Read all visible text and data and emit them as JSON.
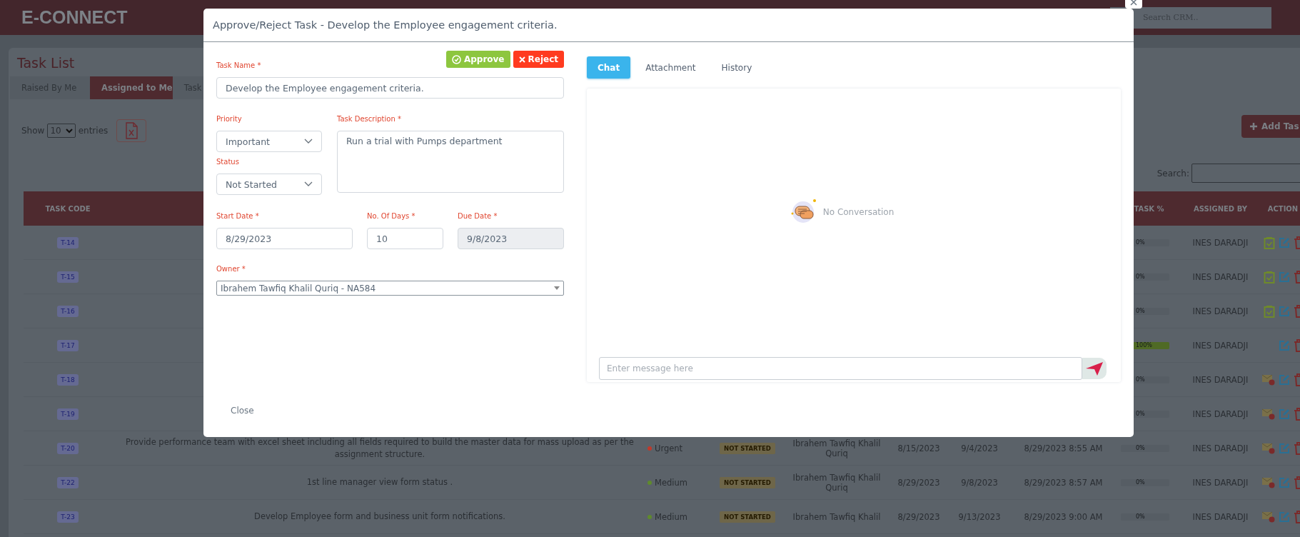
{
  "header": {
    "logo": "E-CONNECT",
    "search_placeholder": "Search CRM.."
  },
  "page": {
    "title": "Task List",
    "tabs": [
      {
        "label": "Raised By Me",
        "selected": false
      },
      {
        "label": "Assigned to Me",
        "selected": true
      },
      {
        "label": "Task",
        "selected": false
      }
    ],
    "show_label": "Show",
    "page_size": "10",
    "entries_label": "entries",
    "add_button": "Add Tas",
    "search_label": "Search:"
  },
  "table": {
    "columns": {
      "code": "TASK CODE",
      "progress": "TASK %",
      "assigned_by": "ASSIGNED BY",
      "action": "ACTION"
    },
    "rows": [
      {
        "code": "T-14",
        "level": 0,
        "progress_label": "0%",
        "assigned_by": "INES DARADJI",
        "approval_pending": true,
        "unread_alert": false
      },
      {
        "code": "T-15",
        "level": 0,
        "progress_label": "0%",
        "assigned_by": "INES DARADJI",
        "approval_pending": true,
        "unread_alert": false
      },
      {
        "code": "T-16",
        "level": 0,
        "progress_label": "0%",
        "assigned_by": "INES DARADJI",
        "approval_pending": true,
        "unread_alert": false
      },
      {
        "code": "T-17",
        "level": 1,
        "progress_label": "100%",
        "assigned_by": "INES DARADJI",
        "approval_pending": false,
        "unread_alert": false
      },
      {
        "code": "T-18",
        "level": 0,
        "progress_label": "0%",
        "assigned_by": "INES DARADJI",
        "approval_pending": false,
        "unread_alert": true
      },
      {
        "code": "T-19",
        "level": 0,
        "progress_label": "0%",
        "assigned_by": "INES DARADJI",
        "approval_pending": false,
        "unread_alert": true
      },
      {
        "code": "T-20",
        "description": "Provide performance team with excel sheet including all fields required to build the master data for mass upload as per the assignment structure.",
        "priority": {
          "label": "Urgent",
          "color": "#c0392b"
        },
        "status": "NOT STARTED",
        "owner": "Ibrahem Tawfiq Khalil Quriq",
        "start": "8/15/2023",
        "due": "9/4/2023",
        "created": "8/29/2023 8:55 AM",
        "level": 0,
        "progress_label": "0%",
        "assigned_by": "INES DARADJI",
        "approval_pending": false,
        "unread_alert": true
      },
      {
        "code": "T-22",
        "description": "1st line manager view form status .",
        "priority": {
          "label": "Medium",
          "color": "#5f8a2c"
        },
        "status": "NOT STARTED",
        "owner": "Ibrahem Tawfiq Khalil Quriq",
        "start": "8/29/2023",
        "due": "9/8/2023",
        "created": "8/29/2023 8:57 AM",
        "level": 0,
        "progress_label": "0%",
        "assigned_by": "INES DARADJI",
        "approval_pending": false,
        "unread_alert": true
      },
      {
        "code": "T-23",
        "description": "Develop Employee form and business unit form notifications.",
        "priority": {
          "label": "Medium",
          "color": "#5f8a2c"
        },
        "status": "NOT STARTED",
        "owner": "Ibrahem Tawfiq Khalil",
        "start": "8/29/2023",
        "due": "9/13/2023",
        "created": "8/29/2023 9:00 AM",
        "level": 0,
        "progress_label": "0%",
        "assigned_by": "INES DARADJI",
        "approval_pending": false,
        "unread_alert": true
      }
    ]
  },
  "modal": {
    "title": "Approve/Reject Task - Develop the Employee engagement criteria.",
    "approve": "Approve",
    "reject": "Reject",
    "form": {
      "task_name": {
        "label": "Task Name *",
        "value": "Develop the Employee engagement criteria.",
        "disabled": false
      },
      "priority": {
        "label": "Priority",
        "value": "Important",
        "disabled": false
      },
      "status": {
        "label": "Status",
        "value": "Not Started",
        "disabled": false
      },
      "description": {
        "label": "Task Description *",
        "value": "Run a trial with Pumps department",
        "disabled": false
      },
      "start_date": {
        "label": "Start Date *",
        "value": "8/29/2023",
        "disabled": false
      },
      "days": {
        "label": "No. Of Days *",
        "value": "10",
        "disabled": false
      },
      "due_date": {
        "label": "Due Date *",
        "value": "9/8/2023",
        "disabled": true
      },
      "owner": {
        "label": "Owner *",
        "value": "Ibrahem Tawfiq Khalil Quriq - NA584",
        "disabled": false
      }
    },
    "tabs": [
      {
        "label": "Chat",
        "selected": true
      },
      {
        "label": "Attachment",
        "selected": false
      },
      {
        "label": "History",
        "selected": false
      }
    ],
    "empty_text": "No Conversation",
    "message_placeholder": "Enter message here",
    "close": "Close"
  }
}
